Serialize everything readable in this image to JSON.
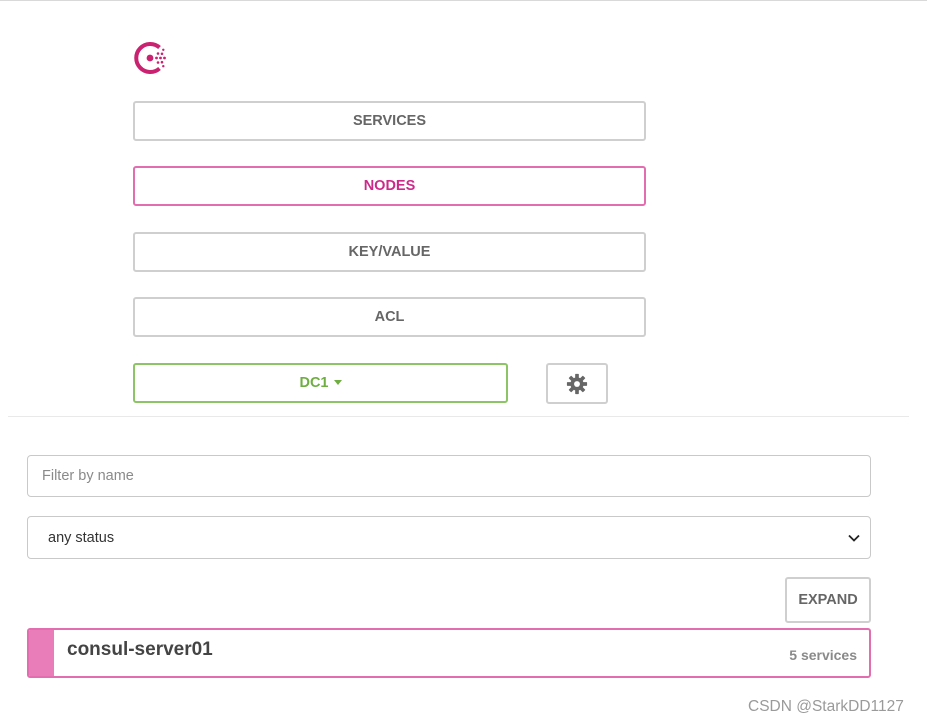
{
  "header": {
    "logo_icon": "consul-logo-icon",
    "brand_color": "#ca2171"
  },
  "nav": {
    "items": [
      {
        "label": "SERVICES",
        "active": false
      },
      {
        "label": "NODES",
        "active": true
      },
      {
        "label": "KEY/VALUE",
        "active": false
      },
      {
        "label": "ACL",
        "active": false
      }
    ],
    "datacenter": {
      "label": "DC1",
      "icon": "caret-down-icon"
    },
    "settings": {
      "icon": "gear-icon"
    }
  },
  "filters": {
    "name_placeholder": "Filter by name",
    "name_value": "",
    "status_selected": "any status",
    "status_icon": "chevron-down-icon"
  },
  "actions": {
    "expand_label": "EXPAND"
  },
  "nodes": [
    {
      "name": "consul-server01",
      "services": "5 services",
      "status_color": "#e87dba"
    }
  ],
  "watermark": "CSDN @StarkDD1127",
  "colors": {
    "active_nav": "#cc2a8b",
    "active_border": "#e26eb0",
    "dc_green": "#6fae41",
    "dc_border": "#8cc466",
    "default_border": "#cfcfcf"
  }
}
